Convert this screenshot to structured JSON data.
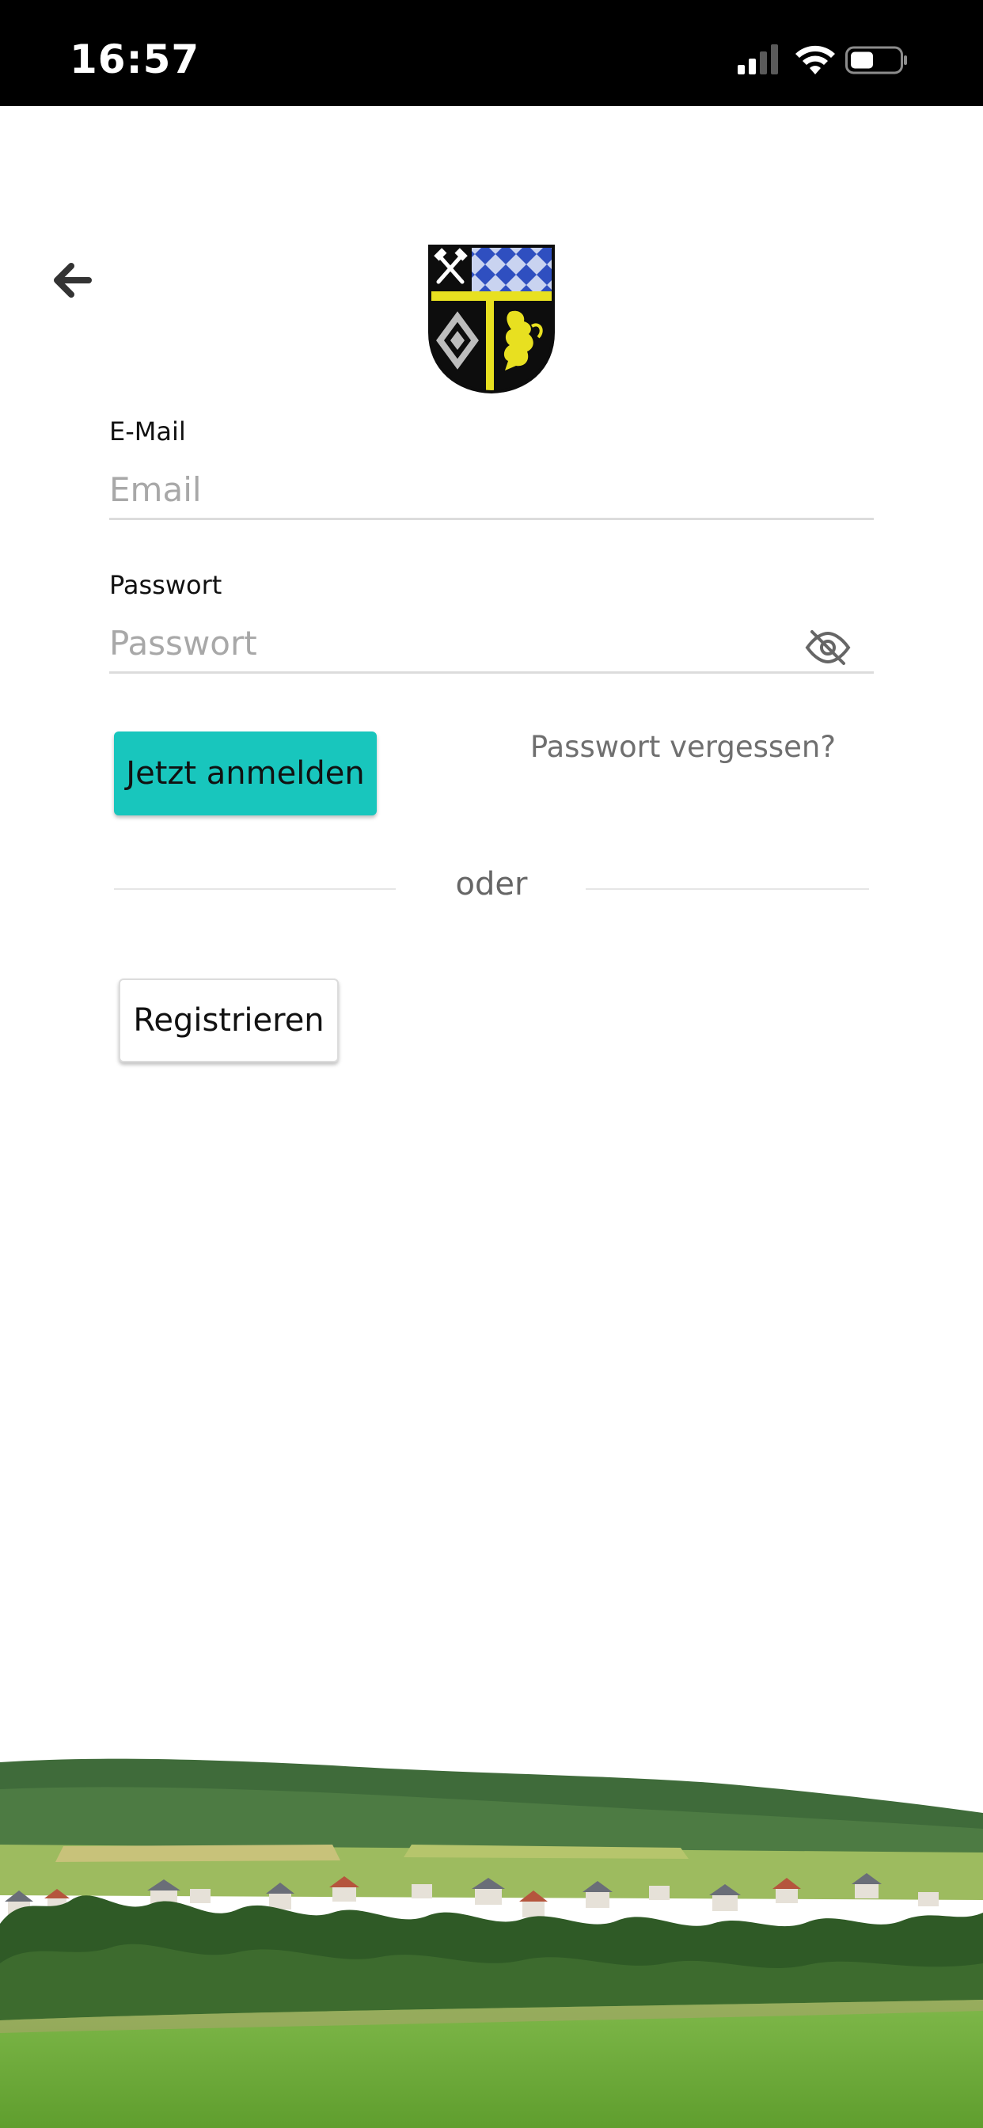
{
  "status_bar": {
    "time": "16:57",
    "icons": [
      "signal-icon",
      "wifi-icon",
      "battery-icon"
    ]
  },
  "header": {
    "back_icon": "arrow-left-icon",
    "logo": "municipal-coat-of-arms"
  },
  "form": {
    "email": {
      "label": "E-Mail",
      "placeholder": "Email",
      "value": ""
    },
    "password": {
      "label": "Passwort",
      "placeholder": "Passwort",
      "value": "",
      "toggle_icon": "eye-off-icon"
    },
    "login_label": "Jetzt anmelden",
    "forgot_label": "Passwort vergessen?",
    "divider_text": "oder",
    "register_label": "Registrieren"
  },
  "colors": {
    "accent": "#18c6bd",
    "status_bar_bg": "#000000",
    "background": "#ffffff"
  },
  "footer": {
    "image": "village-landscape-photo"
  }
}
